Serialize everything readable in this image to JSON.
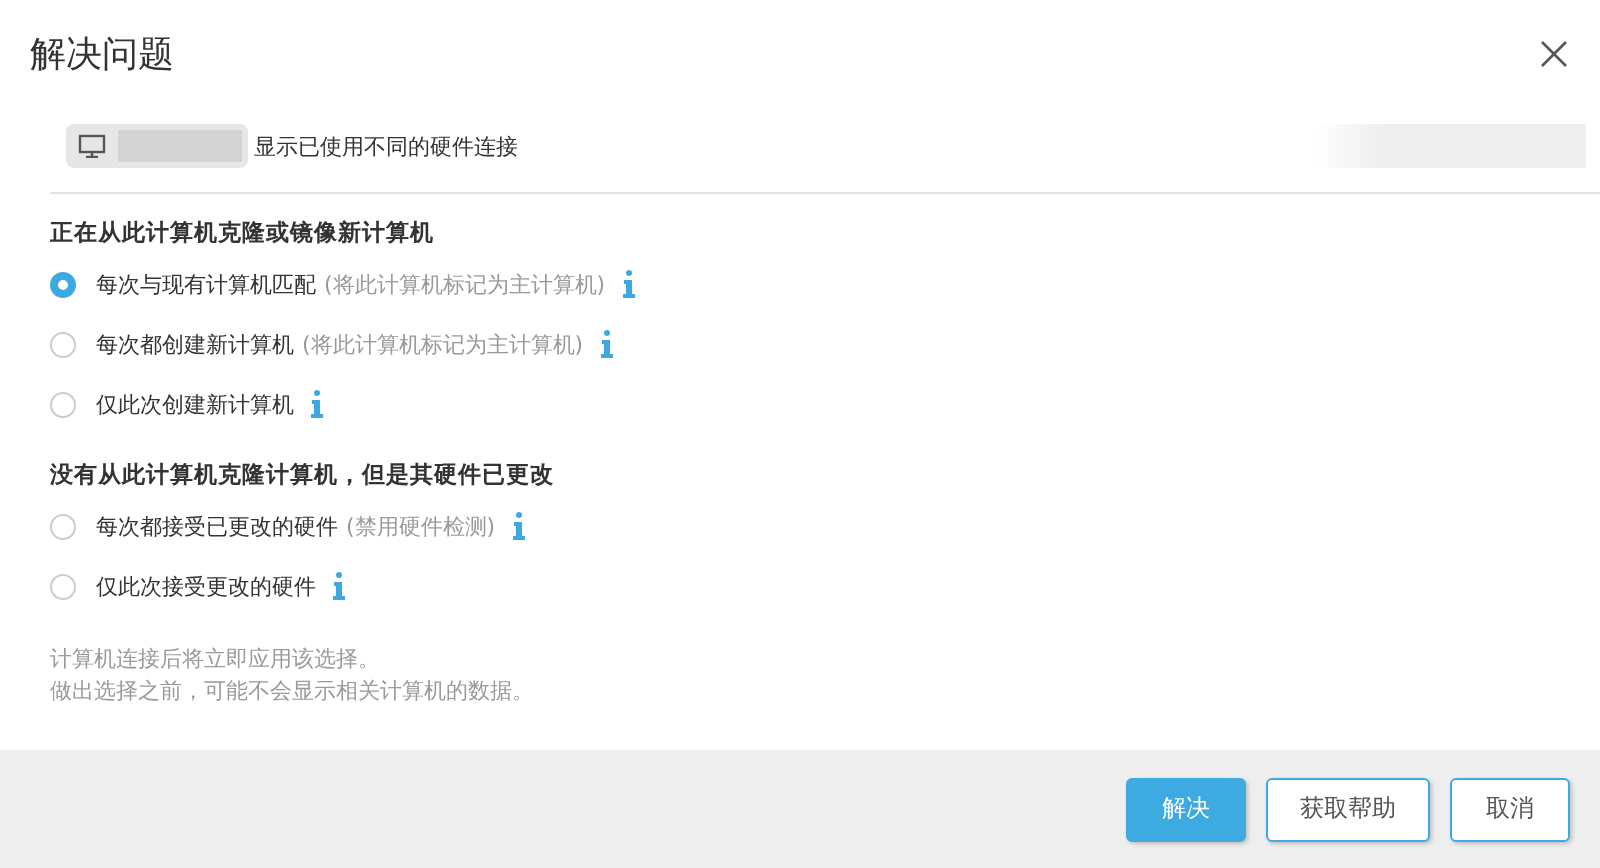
{
  "window": {
    "title": "解决问题"
  },
  "device": {
    "description": "显示已使用不同的硬件连接"
  },
  "groups": [
    {
      "heading": "正在从此计算机克隆或镜像新计算机",
      "options": [
        {
          "label": "每次与现有计算机匹配",
          "hint": "(将此计算机标记为主计算机)",
          "selected": true
        },
        {
          "label": "每次都创建新计算机",
          "hint": "(将此计算机标记为主计算机)",
          "selected": false
        },
        {
          "label": "仅此次创建新计算机",
          "selected": false
        }
      ]
    },
    {
      "heading": "没有从此计算机克隆计算机，但是其硬件已更改",
      "options": [
        {
          "label": "每次都接受已更改的硬件",
          "hint": "(禁用硬件检测)",
          "selected": false
        },
        {
          "label": "仅此次接受更改的硬件",
          "selected": false
        }
      ]
    }
  ],
  "notes": [
    "计算机连接后将立即应用该选择。",
    "做出选择之前，可能不会显示相关计算机的数据。"
  ],
  "buttons": [
    {
      "label": "解决",
      "kind": "primary"
    },
    {
      "label": "获取帮助",
      "kind": "secondary"
    },
    {
      "label": "取消",
      "kind": "secondary"
    }
  ]
}
